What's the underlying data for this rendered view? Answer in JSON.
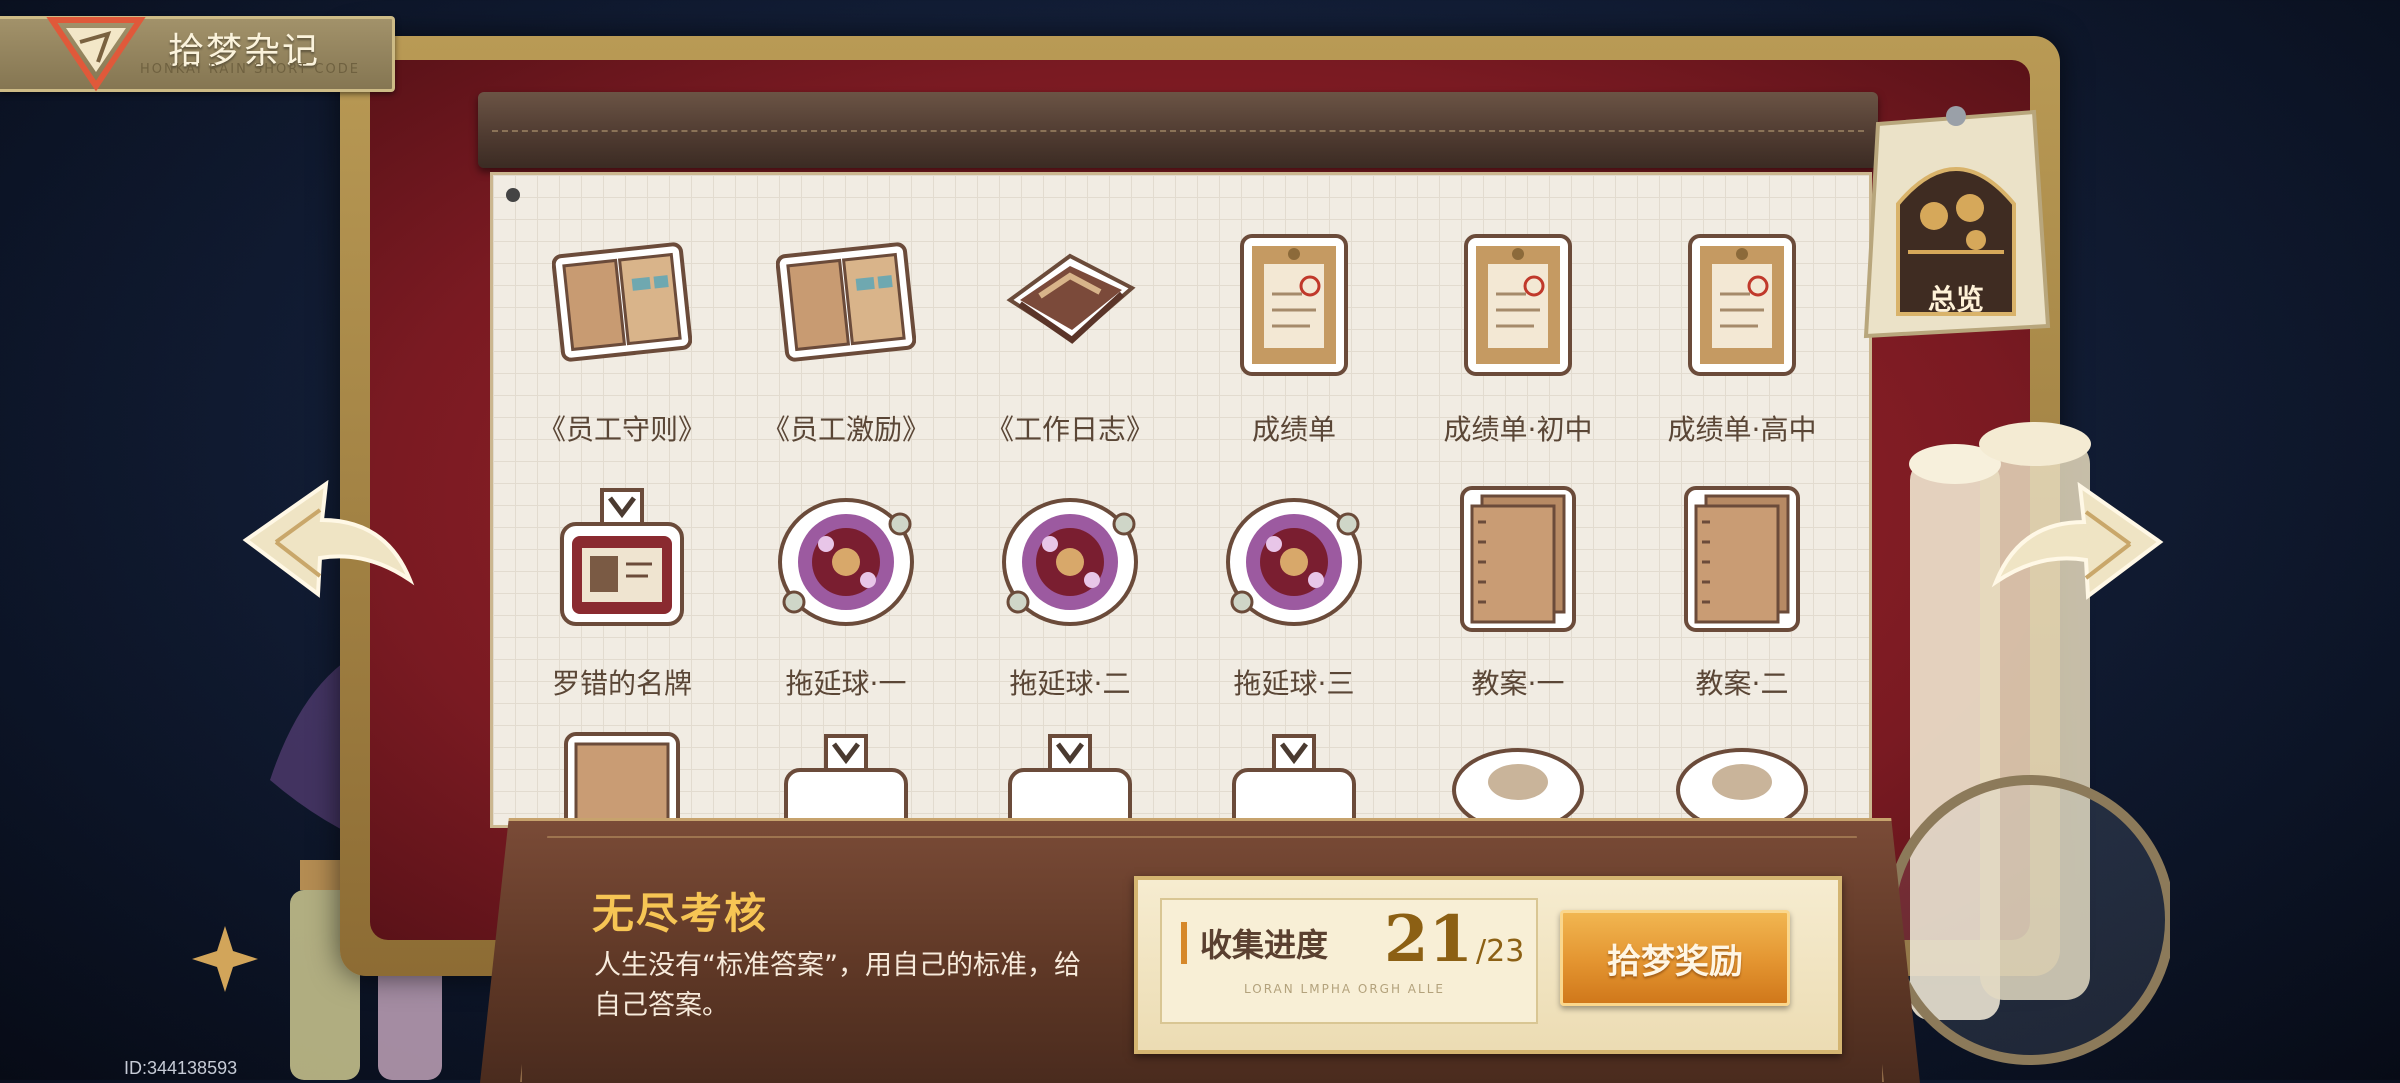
{
  "header": {
    "title": "拾梦杂记",
    "subtitle": "HONKAI RAIN SHORT CODE"
  },
  "overview": {
    "label": "总览"
  },
  "items": [
    {
      "label": "《员工守则》",
      "icon": "open-manual-icon"
    },
    {
      "label": "《员工激励》",
      "icon": "open-manual-icon"
    },
    {
      "label": "《工作日志》",
      "icon": "work-log-book-icon"
    },
    {
      "label": "成绩单",
      "icon": "report-card-envelope-icon"
    },
    {
      "label": "成绩单·初中",
      "icon": "report-card-envelope-icon"
    },
    {
      "label": "成绩单·高中",
      "icon": "report-card-envelope-icon"
    },
    {
      "label": "罗错的名牌",
      "icon": "name-badge-icon"
    },
    {
      "label": "拖延球·一",
      "icon": "procrastination-ball-icon"
    },
    {
      "label": "拖延球·二",
      "icon": "procrastination-ball-icon"
    },
    {
      "label": "拖延球·三",
      "icon": "procrastination-ball-icon"
    },
    {
      "label": "教案·一",
      "icon": "lesson-plan-notebook-icon"
    },
    {
      "label": "教案·二",
      "icon": "lesson-plan-notebook-icon"
    }
  ],
  "info": {
    "title": "无尽考核",
    "description": "人生没有“标准答案”，用自己的标准，给自己答案。"
  },
  "progress": {
    "label": "收集进度",
    "current": "21",
    "total": "/23",
    "fine_print": "LORAN LMPHA ORGH ALLE"
  },
  "reward_button": {
    "label": "拾梦奖励"
  },
  "footer": {
    "id_text": "ID:344138593"
  },
  "colors": {
    "accent_gold": "#f6c554",
    "button_orange": "#e39430",
    "frame_red": "#a4262c",
    "paper": "#f1ece3"
  }
}
